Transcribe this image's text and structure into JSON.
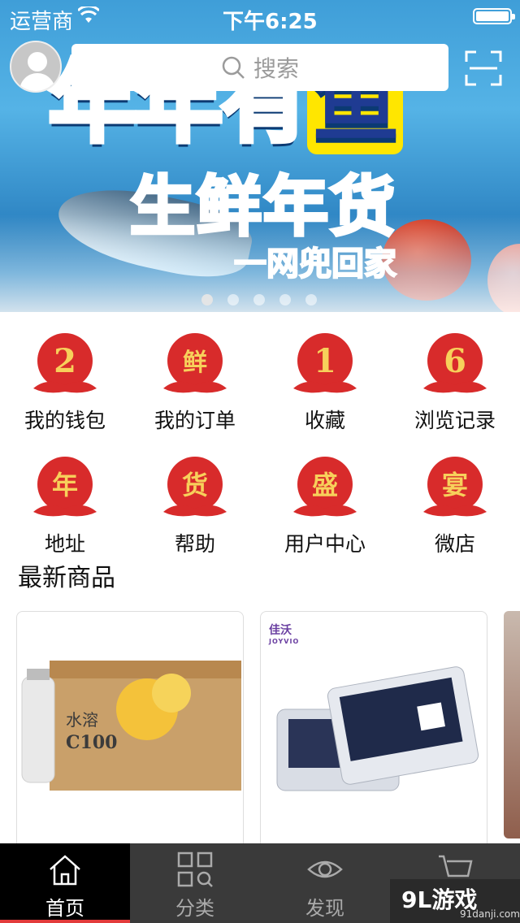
{
  "status_bar": {
    "carrier": "运营商",
    "time": "下午6:25"
  },
  "banner": {
    "title_part1": "年年有",
    "title_part2": "鱼",
    "subtitle": "生鲜年货",
    "tagline": "一网兜回家",
    "page_count": 5,
    "active_index": 0
  },
  "search": {
    "placeholder": "搜索"
  },
  "menu": [
    {
      "label": "我的钱包",
      "glyph": "2"
    },
    {
      "label": "我的订单",
      "glyph": "鲜"
    },
    {
      "label": "收藏",
      "glyph": "1"
    },
    {
      "label": "浏览记录",
      "glyph": "6"
    },
    {
      "label": "地址",
      "glyph": "年"
    },
    {
      "label": "帮助",
      "glyph": "货"
    },
    {
      "label": "用户中心",
      "glyph": "盛"
    },
    {
      "label": "微店",
      "glyph": "宴"
    }
  ],
  "section": {
    "latest_title": "最新商品"
  },
  "products": [
    {
      "brand_text": "水溶",
      "model_text": "C100",
      "type": "drink-box"
    },
    {
      "brand_text": "佳沃",
      "brand_en": "JOYVIO",
      "type": "blueberry-box"
    }
  ],
  "tabbar": [
    {
      "label": "首页",
      "icon": "home-icon",
      "active": true
    },
    {
      "label": "分类",
      "icon": "category-icon",
      "active": false
    },
    {
      "label": "发现",
      "icon": "eye-icon",
      "active": false
    },
    {
      "label": "",
      "icon": "cart-icon",
      "active": false
    }
  ],
  "watermark": {
    "brand": "9L游戏",
    "domain": "91danji.com"
  },
  "colors": {
    "accent_red": "#e23b3b",
    "tabbar_bg": "#3a3a3a",
    "menu_icon_red": "#d82b2b"
  }
}
